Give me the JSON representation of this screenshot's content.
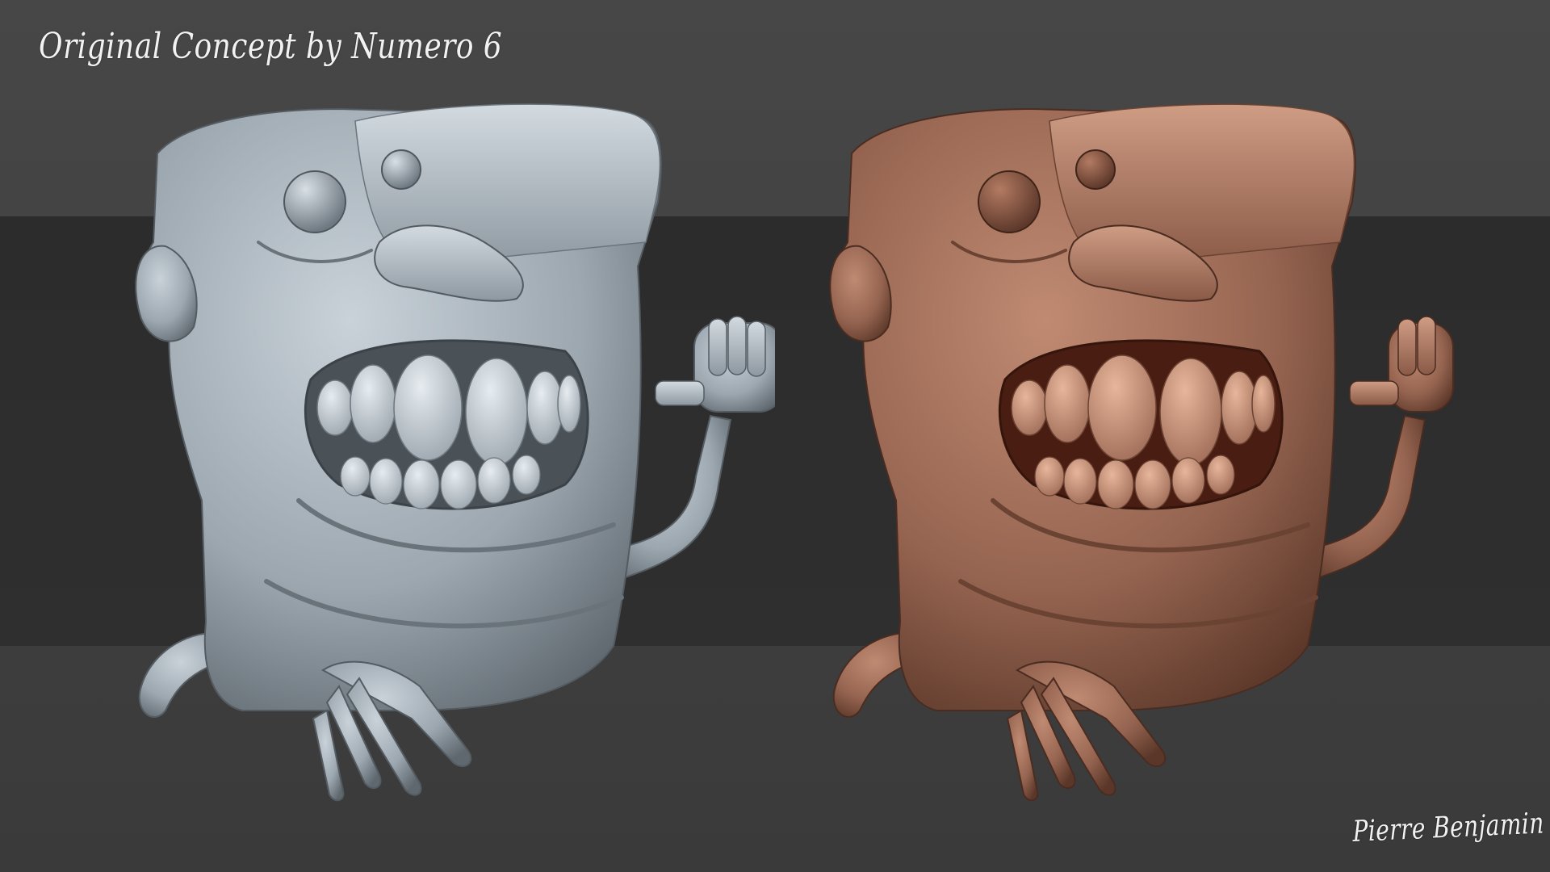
{
  "image": {
    "concept_credit": "Original Concept by Numero 6",
    "artist_signature": "Pierre Benjamin",
    "colors": {
      "background": "#3d3d3d",
      "band": "#2e2e2e",
      "clay_gray": "#b4bdc4",
      "clay_gray_dark": "#7b858d",
      "clay_brown": "#a97560",
      "clay_brown_dark": "#6b4333",
      "text": "#f2f2f2"
    },
    "renders": [
      {
        "material": "matcap-gray"
      },
      {
        "material": "matcap-brown"
      }
    ]
  }
}
